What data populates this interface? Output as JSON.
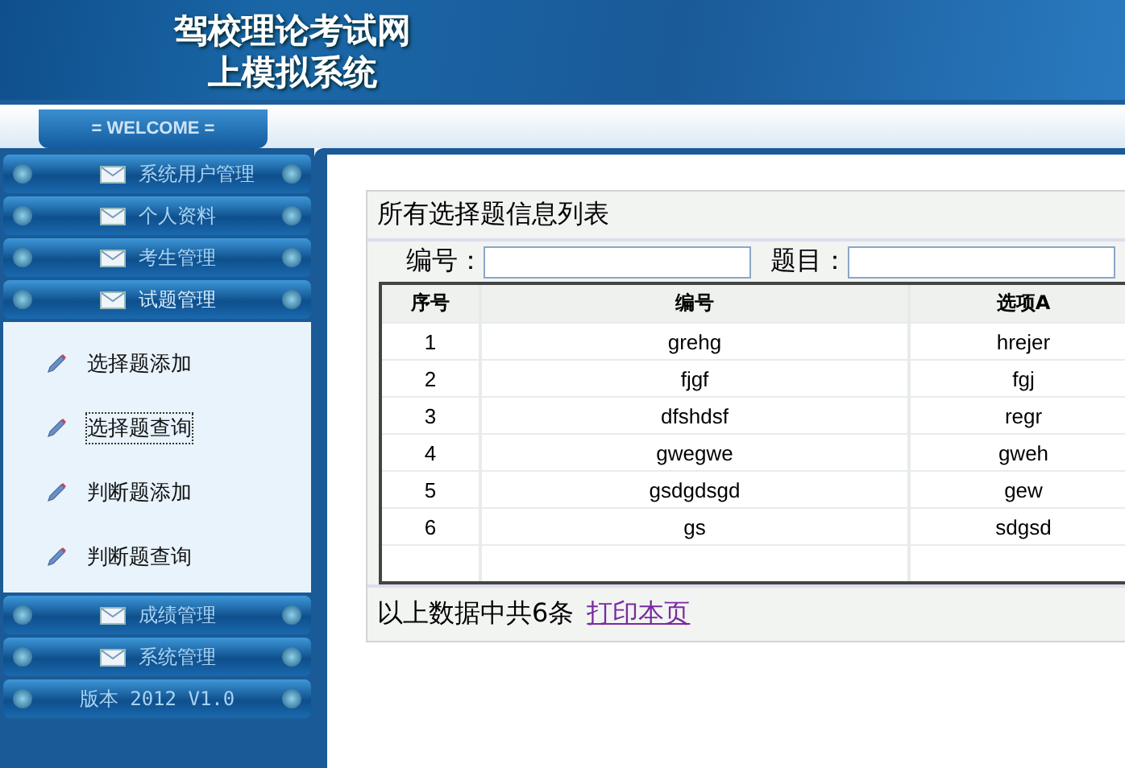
{
  "header": {
    "title_lines": [
      "驾校理论考试网",
      "上模拟系统"
    ]
  },
  "welcome": {
    "label": "= WELCOME ="
  },
  "sidebar": {
    "items": [
      {
        "label": "系统用户管理",
        "expanded": false
      },
      {
        "label": "个人资料",
        "expanded": false
      },
      {
        "label": "考生管理",
        "expanded": false
      },
      {
        "label": "试题管理",
        "expanded": true,
        "children": [
          {
            "label": "选择题添加",
            "selected": false
          },
          {
            "label": "选择题查询",
            "selected": true
          },
          {
            "label": "判断题添加",
            "selected": false
          },
          {
            "label": "判断题查询",
            "selected": false
          }
        ]
      },
      {
        "label": "成绩管理",
        "expanded": false
      },
      {
        "label": "系统管理",
        "expanded": false
      }
    ],
    "version": "版本 2012 V1.0"
  },
  "panel": {
    "title": "所有选择题信息列表",
    "filters": [
      {
        "label": "编号："
      },
      {
        "label": "题目："
      }
    ],
    "table": {
      "columns": [
        "序号",
        "编号",
        "选项A"
      ],
      "rows": [
        [
          "1",
          "grehg",
          "hrejer"
        ],
        [
          "2",
          "fjgf",
          "fgj"
        ],
        [
          "3",
          "dfshdsf",
          "regr"
        ],
        [
          "4",
          "gwegwe",
          "gweh"
        ],
        [
          "5",
          "gsdgdsgd",
          "gew"
        ],
        [
          "6",
          "gs",
          "sdgsd"
        ]
      ]
    },
    "footer_text": "以上数据中共6条",
    "print_link": "打印本页"
  }
}
